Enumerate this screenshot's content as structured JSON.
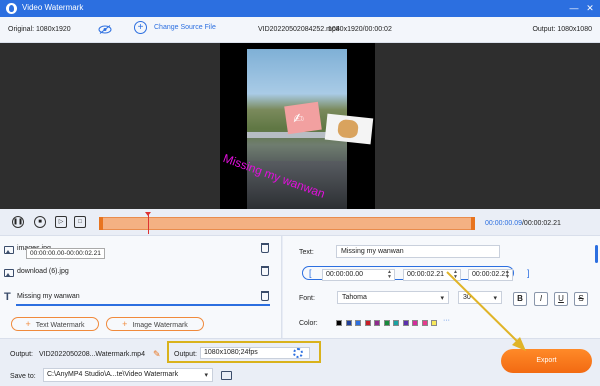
{
  "window": {
    "title": "Video Watermark",
    "minimize": "—",
    "close": "✕"
  },
  "topbar": {
    "original": "Original: 1080x1920",
    "change_source": "Change Source File",
    "file_name": "VID20220502084252.mp4",
    "file_info": "1080x1920/00:00:02",
    "output": "Output: 1080x1080"
  },
  "preview": {
    "watermark_text": "Missing my wanwan"
  },
  "timeline": {
    "current": "00:00:00.09",
    "total": "/00:00:02.21"
  },
  "watermarks": {
    "items": [
      {
        "name": "images.jpg",
        "type": "image"
      },
      {
        "name": "download (6).jpg",
        "type": "image"
      },
      {
        "name": "Missing my wanwan",
        "type": "text"
      }
    ],
    "tooltip": "00:00:00.00-00:00:02.21",
    "add_text": "Text Watermark",
    "add_image": "Image Watermark"
  },
  "editor": {
    "text_label": "Text:",
    "text_value": "Missing my wanwan",
    "start": "00:00:00.00",
    "end": "00:00:02.21",
    "duration": "00:00:02.21",
    "font_label": "Font:",
    "font": "Tahoma",
    "size": "30",
    "color_label": "Color:",
    "more_colors": "···",
    "styles": [
      "B",
      "I",
      "U",
      "S"
    ],
    "colors": [
      "#000000",
      "#1f3f9c",
      "#2c6fe0",
      "#c81d25",
      "#8e2a8e",
      "#178a3c",
      "#1aa3a3",
      "#5b2fae",
      "#d42b9b",
      "#e63a8c",
      "#f7e85a"
    ]
  },
  "bottom": {
    "output_label": "Output:",
    "output_file": "VID2022050208...Watermark.mp4",
    "output2_label": "Output:",
    "output_settings": "1080x1080;24fps",
    "save_label": "Save to:",
    "save_path": "C:\\AnyMP4 Studio\\A...te\\Video Watermark",
    "export": "Export"
  },
  "colors": {
    "accent": "#2c6fe0",
    "export": "#f26a12",
    "highlight": "#d9b21c"
  }
}
